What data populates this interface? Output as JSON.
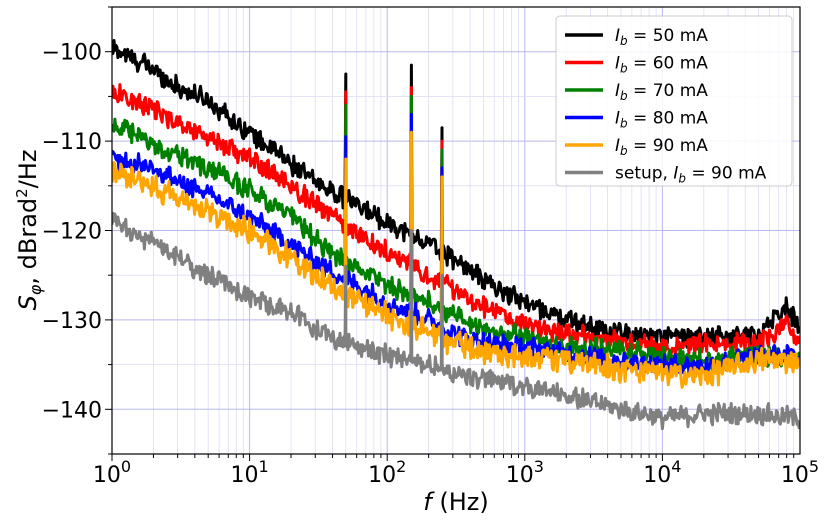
{
  "chart_data": {
    "type": "line",
    "title": "",
    "xlabel": "f (Hz)",
    "ylabel": "S_φ, dBrad²/Hz",
    "xscale": "log",
    "xlim": [
      1,
      100000
    ],
    "ylim": [
      -145,
      -95
    ],
    "grid": "on (major and minor, light blue)",
    "legend_position": "top-right",
    "x_ticks": [
      {
        "value": 1,
        "base": "10",
        "exp": "0"
      },
      {
        "value": 10,
        "base": "10",
        "exp": "1"
      },
      {
        "value": 100,
        "base": "10",
        "exp": "2"
      },
      {
        "value": 1000,
        "base": "10",
        "exp": "3"
      },
      {
        "value": 10000,
        "base": "10",
        "exp": "4"
      },
      {
        "value": 100000,
        "base": "10",
        "exp": "5"
      }
    ],
    "y_ticks": [
      {
        "value": -100,
        "label": "−100"
      },
      {
        "value": -110,
        "label": "−110"
      },
      {
        "value": -120,
        "label": "−120"
      },
      {
        "value": -130,
        "label": "−130"
      },
      {
        "value": -140,
        "label": "−140"
      }
    ],
    "series": [
      {
        "name": "I_b = 50 mA",
        "prefix": "",
        "sub": "b",
        "suffix": " = 50 mA",
        "color": "#000000",
        "noise": 1.0,
        "points": [
          [
            1,
            -99.5
          ],
          [
            2,
            -102
          ],
          [
            3,
            -104
          ],
          [
            5,
            -105.5
          ],
          [
            10,
            -109
          ],
          [
            20,
            -112.5
          ],
          [
            30,
            -114.5
          ],
          [
            50,
            -116.5
          ],
          [
            100,
            -119
          ],
          [
            200,
            -121.5
          ],
          [
            300,
            -123
          ],
          [
            500,
            -125.5
          ],
          [
            1000,
            -128
          ],
          [
            2000,
            -130
          ],
          [
            5000,
            -131.5
          ],
          [
            10000,
            -131.8
          ],
          [
            20000,
            -132
          ],
          [
            50000,
            -131.5
          ],
          [
            80000,
            -128.5
          ],
          [
            100000,
            -131
          ]
        ],
        "spikes": [
          [
            50,
            -102.5
          ],
          [
            150,
            -101.5
          ],
          [
            250,
            -108.5
          ]
        ]
      },
      {
        "name": "I_b = 60 mA",
        "prefix": "",
        "sub": "b",
        "suffix": " = 60 mA",
        "color": "#ff0000",
        "noise": 1.0,
        "points": [
          [
            1,
            -104.5
          ],
          [
            2,
            -106.5
          ],
          [
            3,
            -108
          ],
          [
            5,
            -109.5
          ],
          [
            10,
            -112
          ],
          [
            20,
            -115
          ],
          [
            30,
            -117
          ],
          [
            50,
            -119.5
          ],
          [
            100,
            -122.5
          ],
          [
            200,
            -125
          ],
          [
            300,
            -126.5
          ],
          [
            500,
            -128.5
          ],
          [
            1000,
            -130.5
          ],
          [
            2000,
            -131.5
          ],
          [
            5000,
            -132.5
          ],
          [
            10000,
            -133
          ],
          [
            20000,
            -132.8
          ],
          [
            50000,
            -132.5
          ],
          [
            80000,
            -130.5
          ],
          [
            100000,
            -133
          ]
        ],
        "spikes": [
          [
            50,
            -104.5
          ],
          [
            150,
            -104
          ],
          [
            250,
            -110
          ]
        ]
      },
      {
        "name": "I_b = 70 mA",
        "prefix": "",
        "sub": "b",
        "suffix": " = 70 mA",
        "color": "#008000",
        "noise": 1.0,
        "points": [
          [
            1,
            -108
          ],
          [
            2,
            -110.5
          ],
          [
            3,
            -111.5
          ],
          [
            5,
            -113
          ],
          [
            10,
            -115.5
          ],
          [
            20,
            -118.5
          ],
          [
            30,
            -121
          ],
          [
            50,
            -123.5
          ],
          [
            100,
            -126
          ],
          [
            200,
            -128
          ],
          [
            300,
            -129.5
          ],
          [
            500,
            -131
          ],
          [
            1000,
            -132
          ],
          [
            2000,
            -133
          ],
          [
            5000,
            -133.5
          ],
          [
            10000,
            -134
          ],
          [
            20000,
            -134.5
          ],
          [
            50000,
            -133.8
          ],
          [
            100000,
            -134.5
          ]
        ],
        "spikes": [
          [
            50,
            -106
          ],
          [
            150,
            -105
          ],
          [
            250,
            -111
          ]
        ]
      },
      {
        "name": "I_b = 80 mA",
        "prefix": "",
        "sub": "b",
        "suffix": " = 80 mA",
        "color": "#0000ff",
        "noise": 1.0,
        "points": [
          [
            1,
            -112
          ],
          [
            2,
            -113
          ],
          [
            3,
            -114.5
          ],
          [
            5,
            -116
          ],
          [
            10,
            -118.5
          ],
          [
            20,
            -121.5
          ],
          [
            30,
            -123.5
          ],
          [
            50,
            -125.5
          ],
          [
            100,
            -128
          ],
          [
            200,
            -130
          ],
          [
            300,
            -131.5
          ],
          [
            500,
            -132.5
          ],
          [
            1000,
            -133
          ],
          [
            2000,
            -133.8
          ],
          [
            5000,
            -134.5
          ],
          [
            10000,
            -135
          ],
          [
            20000,
            -135.2
          ],
          [
            50000,
            -134
          ],
          [
            100000,
            -134
          ]
        ],
        "spikes": [
          [
            50,
            -109.5
          ],
          [
            150,
            -107
          ],
          [
            250,
            -113
          ]
        ]
      },
      {
        "name": "I_b = 90 mA",
        "prefix": "",
        "sub": "b",
        "suffix": " = 90 mA",
        "color": "#ffa500",
        "noise": 1.2,
        "points": [
          [
            1,
            -113.5
          ],
          [
            2,
            -115
          ],
          [
            3,
            -116.5
          ],
          [
            5,
            -118
          ],
          [
            10,
            -120
          ],
          [
            20,
            -123
          ],
          [
            30,
            -125
          ],
          [
            50,
            -127
          ],
          [
            100,
            -129.5
          ],
          [
            200,
            -131.5
          ],
          [
            300,
            -132.5
          ],
          [
            500,
            -133.5
          ],
          [
            1000,
            -134
          ],
          [
            2000,
            -134.5
          ],
          [
            5000,
            -135.5
          ],
          [
            10000,
            -136
          ],
          [
            20000,
            -136.2
          ],
          [
            50000,
            -134.5
          ],
          [
            100000,
            -134.5
          ]
        ],
        "spikes": [
          [
            50,
            -112
          ],
          [
            150,
            -109
          ],
          [
            250,
            -114
          ]
        ]
      },
      {
        "name": "setup, I_b = 90 mA",
        "prefix": "setup, ",
        "sub": "b",
        "suffix": " = 90 mA",
        "color": "#808080",
        "noise": 1.0,
        "points": [
          [
            1,
            -119
          ],
          [
            2,
            -121.5
          ],
          [
            3,
            -123
          ],
          [
            5,
            -125
          ],
          [
            10,
            -127.5
          ],
          [
            20,
            -129
          ],
          [
            30,
            -131
          ],
          [
            50,
            -132.5
          ],
          [
            100,
            -134
          ],
          [
            200,
            -135
          ],
          [
            300,
            -136
          ],
          [
            500,
            -136.5
          ],
          [
            1000,
            -137.5
          ],
          [
            2000,
            -138.5
          ],
          [
            5000,
            -140
          ],
          [
            10000,
            -141
          ],
          [
            20000,
            -140.5
          ],
          [
            50000,
            -140.5
          ],
          [
            100000,
            -141
          ]
        ],
        "spikes": [
          [
            50,
            -124
          ],
          [
            150,
            -120
          ],
          [
            250,
            -125
          ]
        ]
      }
    ]
  }
}
